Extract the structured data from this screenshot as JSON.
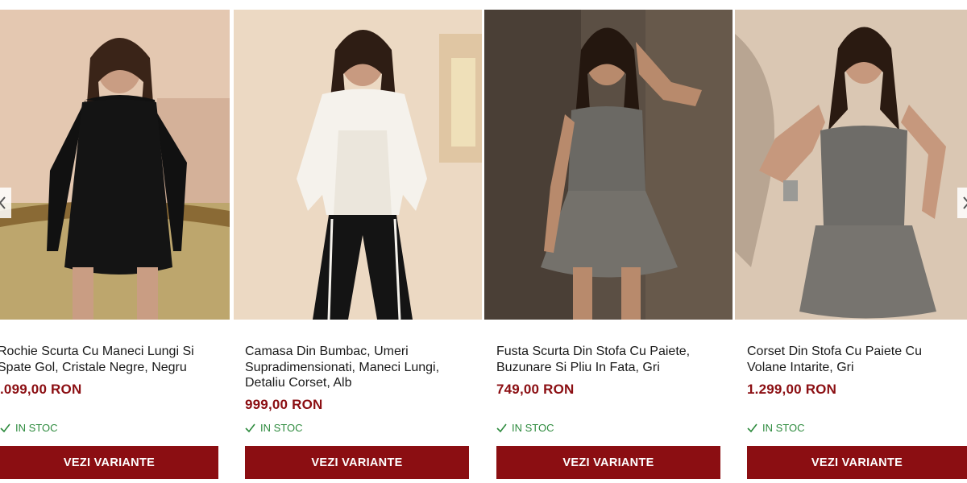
{
  "products": [
    {
      "title": "Rochie Scurta Cu Maneci Lungi Si Spate Gol, Cristale Negre, Negru",
      "price": ".099,00 RON",
      "stock": "IN STOC",
      "button": "VEZI VARIANTE",
      "colors": {
        "bg": "#e6cdb8",
        "outfit": "#141414"
      }
    },
    {
      "title": "Camasa Din Bumbac, Umeri Supradimensionati, Maneci Lungi, Detaliu Corset, Alb",
      "price": "999,00 RON",
      "stock": "IN STOC",
      "button": "VEZI VARIANTE",
      "colors": {
        "bg": "#e9d6bf",
        "outfit": "#f4f1ea"
      }
    },
    {
      "title": "Fusta Scurta Din Stofa Cu Paiete, Buzunare Si Pliu In Fata, Gri",
      "price": "749,00 RON",
      "stock": "IN STOC",
      "button": "VEZI VARIANTE",
      "colors": {
        "bg": "#5a4e43",
        "outfit": "#6e6c66"
      }
    },
    {
      "title": "Corset Din Stofa Cu Paiete Cu Volane Intarite, Gri",
      "price": "1.299,00 RON",
      "stock": "IN STOC",
      "button": "VEZI VARIANTE",
      "colors": {
        "bg": "#d8c6b2",
        "outfit": "#6f6c68"
      }
    }
  ],
  "carousel": {
    "prev_icon": "chevron-left-icon",
    "next_icon": "chevron-right-icon"
  },
  "theme": {
    "accent": "#8b0e12",
    "stock_green": "#2e8b3e"
  }
}
